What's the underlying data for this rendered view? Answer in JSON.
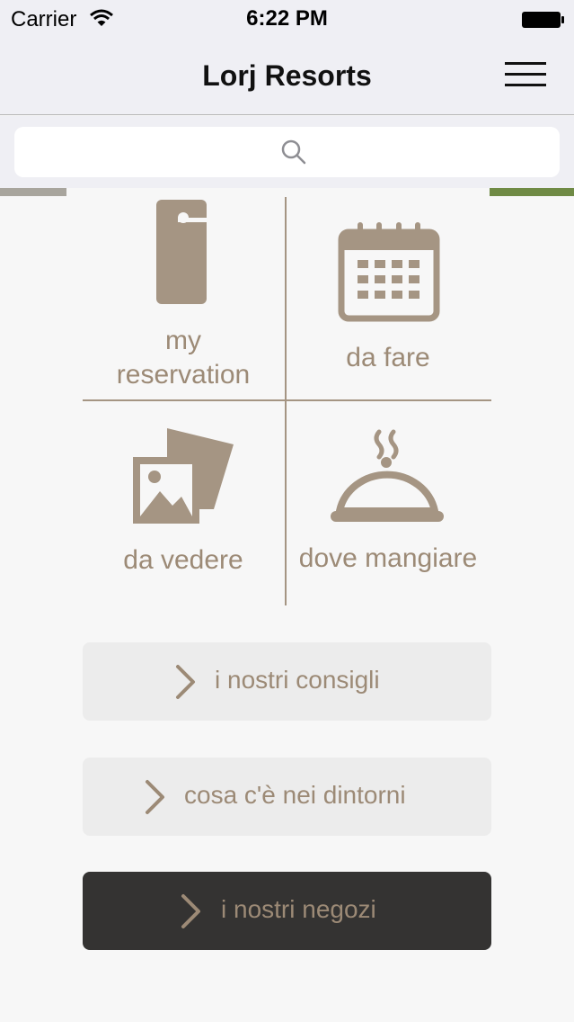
{
  "status_bar": {
    "carrier": "Carrier",
    "time": "6:22 PM"
  },
  "nav": {
    "title": "Lorj Resorts"
  },
  "search": {
    "placeholder": ""
  },
  "tiles": [
    {
      "label_line1": "my",
      "label_line2": "reservation",
      "icon": "door-hanger-icon"
    },
    {
      "label": "da fare",
      "icon": "calendar-icon"
    },
    {
      "label": "da vedere",
      "icon": "photos-icon"
    },
    {
      "label": "dove mangiare",
      "icon": "cloche-icon"
    }
  ],
  "buttons": [
    {
      "label": "i nostri consigli"
    },
    {
      "label": "cosa c'è nei dintorni"
    },
    {
      "label": "i nostri negozi"
    }
  ],
  "colors": {
    "accent": "#9c8a76",
    "bar_bg": "#efeff4",
    "dark_button": "#343332",
    "light_button": "#ececec"
  }
}
